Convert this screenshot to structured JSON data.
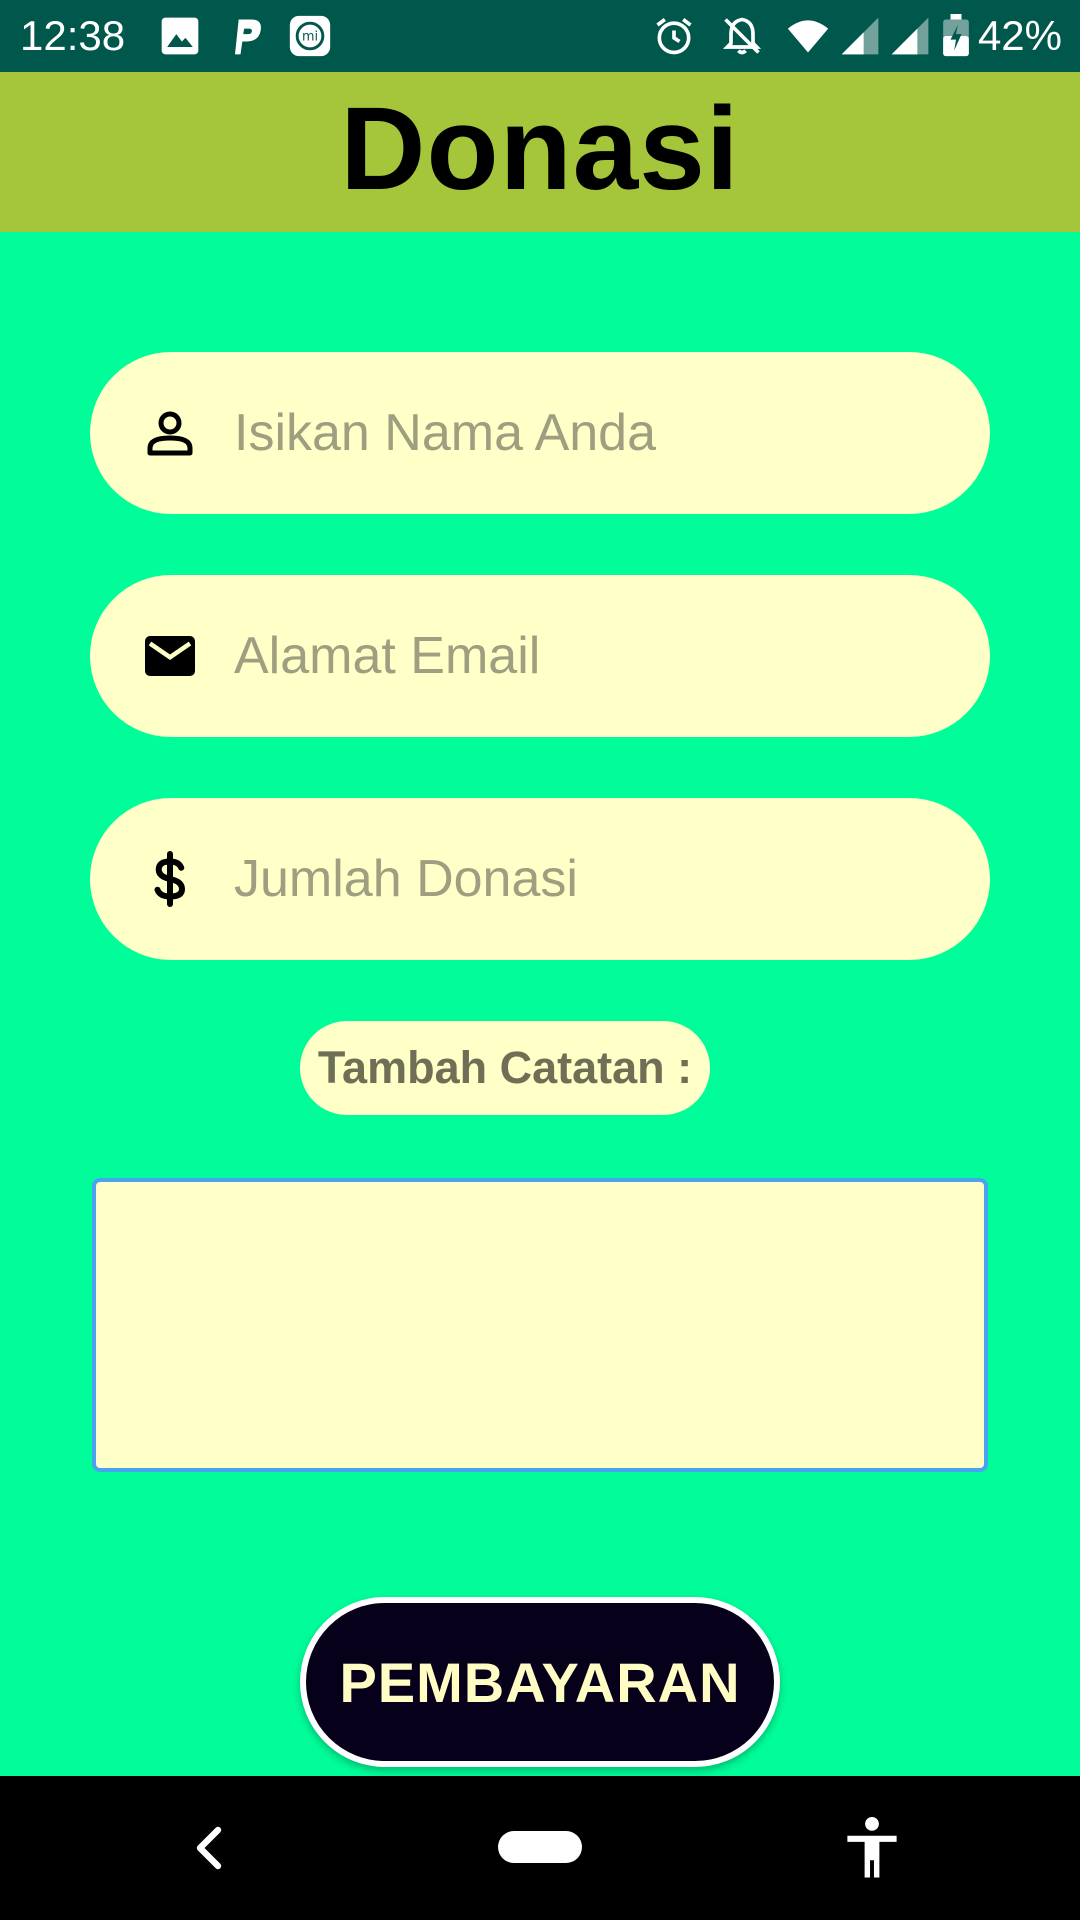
{
  "status_bar": {
    "time": "12:38",
    "battery": "42%",
    "icons": [
      "image-icon",
      "p-app-icon",
      "mi-app-icon",
      "alarm-icon",
      "notifications-off-icon",
      "wifi-icon",
      "signal-icon",
      "signal-icon-2",
      "battery-icon"
    ]
  },
  "header": {
    "title": "Donasi"
  },
  "form": {
    "name_placeholder": "Isikan Nama Anda",
    "name_icon": "person-icon",
    "email_placeholder": "Alamat Email",
    "email_icon": "mail-icon",
    "amount_placeholder": "Jumlah Donasi",
    "amount_icon": "dollar-icon",
    "notes_label": "Tambah Catatan :",
    "notes_value": "",
    "submit_label": "PEMBAYARAN"
  },
  "nav_bar": {
    "icons": [
      "back-icon",
      "home-pill-icon",
      "accessibility-icon"
    ]
  },
  "colors": {
    "status_bar": "#00574b",
    "header": "#a5c63b",
    "background": "#00fd99",
    "field": "#ffffc8",
    "button": "#06001a",
    "button_text": "#fffdc4",
    "focus_border": "#4aa3f0"
  }
}
